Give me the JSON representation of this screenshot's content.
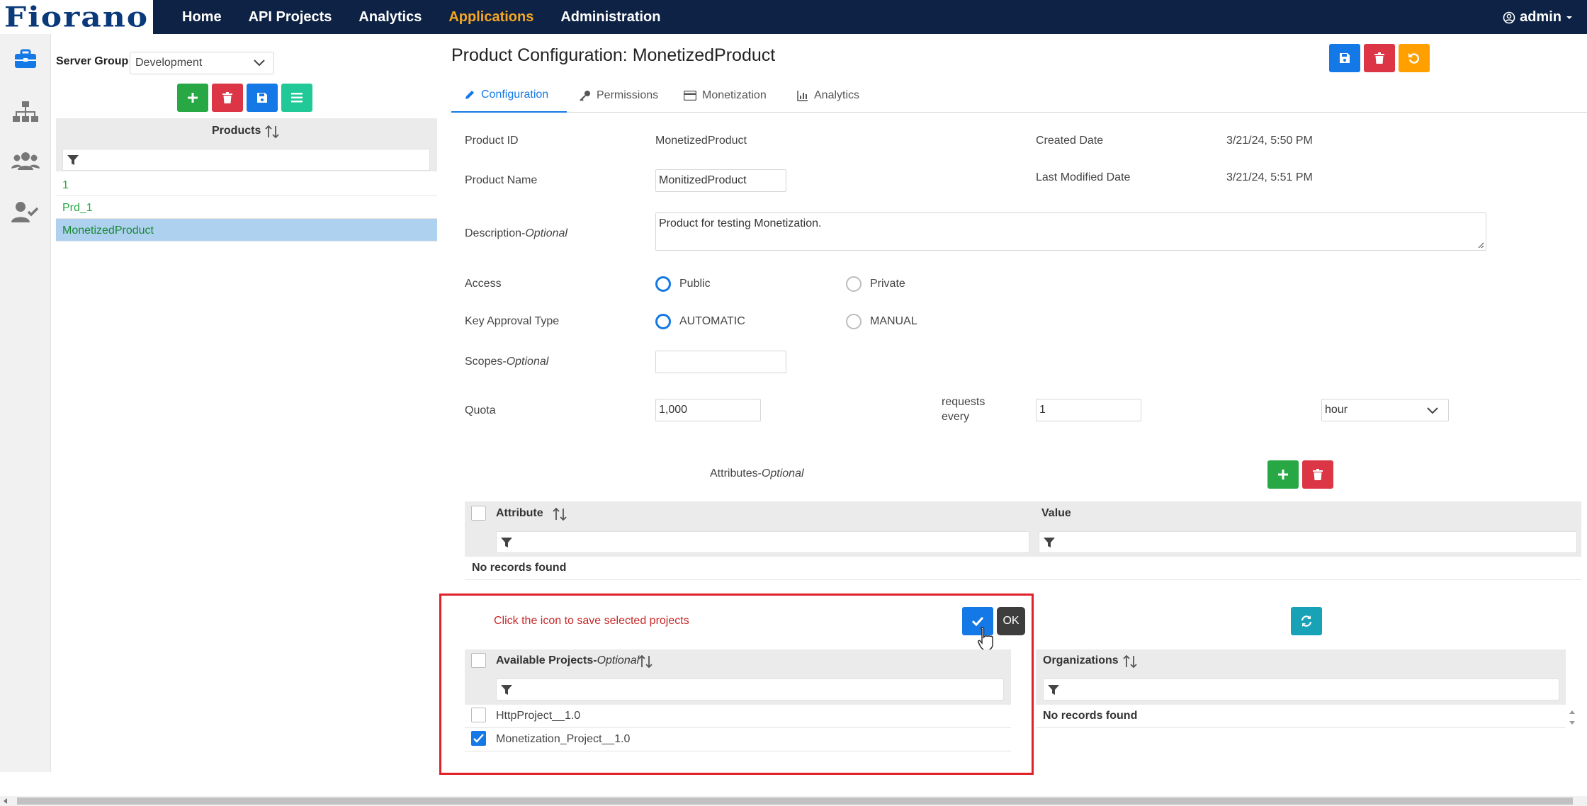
{
  "brand": {
    "logo_text": "Fiorano"
  },
  "nav": {
    "items": [
      "Home",
      "API Projects",
      "Analytics",
      "Applications",
      "Administration"
    ],
    "active": "Applications"
  },
  "user": {
    "name": "admin"
  },
  "sidebar": {
    "server_group_label": "Server Group",
    "server_group_value": "Development",
    "products_header": "Products",
    "products": [
      "1",
      "Prd_1",
      "MonetizedProduct"
    ],
    "selected_product": "MonetizedProduct"
  },
  "main": {
    "title": "Product Configuration: MonetizedProduct",
    "tabs": [
      "Configuration",
      "Permissions",
      "Monetization",
      "Analytics"
    ],
    "active_tab": "Configuration",
    "fields": {
      "product_id_label": "Product ID",
      "product_id": "MonetizedProduct",
      "created_label": "Created Date",
      "created": "3/21/24, 5:50 PM",
      "product_name_label": "Product Name",
      "product_name": "MonitizedProduct",
      "modified_label": "Last Modified Date",
      "modified": "3/21/24, 5:51 PM",
      "description_label": "Description-",
      "optional": "Optional",
      "description": "Product for testing Monetization.",
      "access_label": "Access",
      "access_public": "Public",
      "access_private": "Private",
      "key_approval_label": "Key Approval Type",
      "key_automatic": "AUTOMATIC",
      "key_manual": "MANUAL",
      "scopes_label": "Scopes-",
      "scopes": "",
      "quota_label": "Quota",
      "quota": "1,000",
      "requests_every": "requests every",
      "interval": "1",
      "unit": "hour"
    },
    "attributes": {
      "label": "Attributes-",
      "col_attribute": "Attribute",
      "col_value": "Value",
      "empty": "No records found"
    },
    "projects": {
      "hint": "Click the icon to save selected projects",
      "ok_label": "OK",
      "header": "Available Projects-",
      "items": [
        {
          "name": "HttpProject__1.0",
          "checked": false
        },
        {
          "name": "Monetization_Project__1.0",
          "checked": true
        }
      ]
    },
    "organizations": {
      "header": "Organizations",
      "empty": "No records found"
    }
  },
  "colors": {
    "navy": "#0d2244",
    "accent": "#f5a623",
    "primary": "#1479e6",
    "success": "#28a745",
    "danger": "#dc3545",
    "highlight": "#e0202a"
  }
}
